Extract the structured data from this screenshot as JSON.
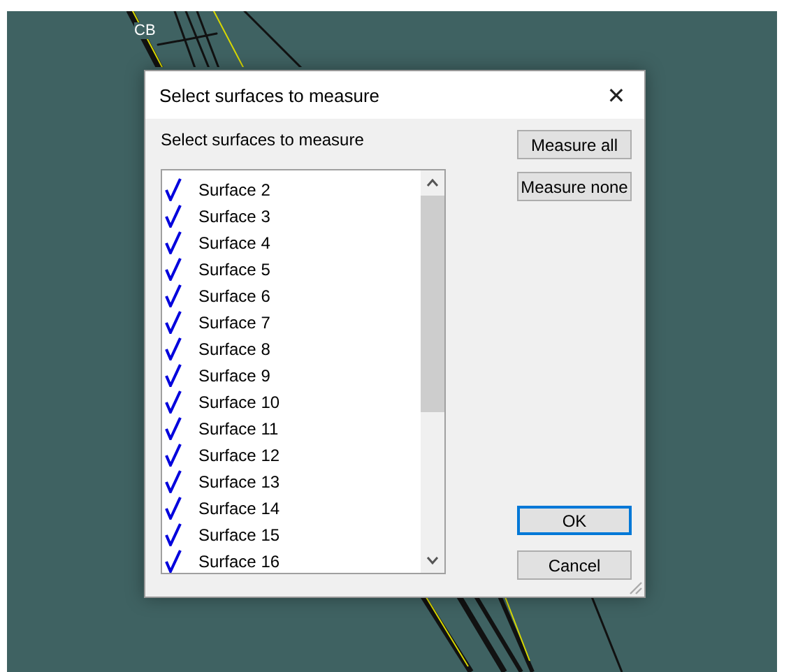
{
  "canvas": {
    "label": "CB"
  },
  "dialog": {
    "title": "Select surfaces to measure",
    "close": "✕",
    "prompt": "Select surfaces to measure",
    "surfaces": [
      {
        "label": "Surface 2",
        "checked": true
      },
      {
        "label": "Surface 3",
        "checked": true
      },
      {
        "label": "Surface 4",
        "checked": true
      },
      {
        "label": "Surface 5",
        "checked": true
      },
      {
        "label": "Surface 6",
        "checked": true
      },
      {
        "label": "Surface 7",
        "checked": true
      },
      {
        "label": "Surface 8",
        "checked": true
      },
      {
        "label": "Surface 9",
        "checked": true
      },
      {
        "label": "Surface 10",
        "checked": true
      },
      {
        "label": "Surface 11",
        "checked": true
      },
      {
        "label": "Surface 12",
        "checked": true
      },
      {
        "label": "Surface 13",
        "checked": true
      },
      {
        "label": "Surface 14",
        "checked": true
      },
      {
        "label": "Surface 15",
        "checked": true
      },
      {
        "label": "Surface 16",
        "checked": true
      }
    ],
    "buttons": [
      {
        "label": "Measure all",
        "kind": "top",
        "default": false
      },
      {
        "label": "Measure none",
        "kind": "top",
        "default": false
      },
      {
        "label": "OK",
        "kind": "bottom",
        "default": true
      },
      {
        "label": "Cancel",
        "kind": "bottom",
        "default": false
      }
    ]
  }
}
